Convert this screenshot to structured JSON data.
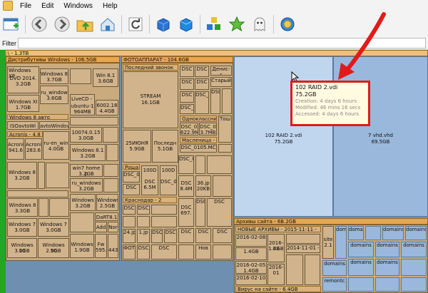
{
  "menu": [
    "File",
    "Edit",
    "Windows",
    "Help"
  ],
  "filter": {
    "label": "Filter",
    "value": ""
  },
  "treemap": {
    "root": "D:\\ - 1.3TB",
    "groups": {
      "distr": "Дистрибутивы Windows - 106.5GB",
      "photo": "ФОТОАППАРАТ - 104.6GB",
      "photo_last": "Последний звонок 62",
      "arch": "Архивы сайта - 6B.2GB",
      "new_arch": "НОВЫЕ АРХИВЫ - 2015-11-11 -",
      "virus": "Вирус на сайте - 6.4GB"
    },
    "items": {
      "raid": {
        "name": "102 RAID 2.vdi",
        "size": "75.2GB"
      },
      "vhd": {
        "name": "7 vhd.vhd",
        "size": "69.5GB"
      },
      "stream": {
        "name": "STREAM",
        "size": "16.1GB"
      },
      "jun": {
        "name": "25ИЮНЯ",
        "size": "5.9GB"
      },
      "last": {
        "name": "Последн",
        "size": "5.1GB"
      }
    },
    "labels": [
      "Windows XP",
      "DVD 2014.",
      "3.2GB",
      "Windows 8",
      "3.7GB",
      "Win 8.1",
      "3.6GB",
      "ru_window",
      "3.6GB",
      "Windows XI",
      "1.7GB",
      "LiveCD -",
      "ubuntu-1",
      "964MB",
      "6002.18",
      "4.4GB",
      "Windows 8 авто устано",
      "ISOavtoWi",
      "avtoWindov",
      "Acronis - 4.8",
      "Acroni",
      "941.6",
      "Acroni",
      "283.6",
      "ru-en_win",
      "4.0GB",
      "10074.0.15",
      "3.0GB",
      "Windows 8.1",
      "3.2GB",
      "Windows 8",
      "3.2GB",
      "win7 home p",
      "3.2GB",
      "ru_windows",
      "3.2GB",
      "Windows",
      "3.2GB",
      "Windows",
      "2.5GB",
      "Windows",
      "2.5GB",
      "Windows 8",
      "3.3GB",
      "Windows 7",
      "3.0GB",
      "Windows 7",
      "3.0GB",
      "DaRT8.1",
      "Add",
      "Nor",
      "Windows 10",
      "3.0GB",
      "Windows 10",
      "2.9GB",
      "Windows",
      "1.9GB",
      "Fw",
      "595.",
      "443"
    ],
    "dsc": [
      "DSC",
      "DSC",
      "DSC",
      "DSC",
      "DSC",
      "DSC_0",
      "DSC_0",
      "DSC",
      "Денис-с",
      "Старый",
      "Одноклассники",
      "Тош",
      "DSC_0",
      "DSC_0",
      "622.9M",
      "3.7MB",
      "Масленица - 9",
      "DSC_0105.MC",
      "Роша",
      "100D",
      "100D",
      "DSC_0",
      "DSC_0",
      "DSC",
      "DSC",
      "6.5M",
      "DSC_0",
      "Краснодар - 2",
      "DSC",
      "DSC",
      "8.4M",
      "36.jp",
      "20KB",
      "DSC",
      "DSC",
      "697.",
      "DSC",
      "DSC",
      "DSC",
      "ФОТ",
      "DSC",
      "DSC",
      "24.jp",
      "1.jp",
      "DSC",
      "DSC",
      "DSC",
      "DSC",
      "Нов"
    ],
    "arch_items": [
      "domains",
      "domai",
      "domains",
      "domains",
      "domains",
      "domains",
      "domains",
      "domains",
      "domains",
      "2016-03",
      "1.4GB",
      "2014-11-01 -",
      "site",
      "2.1",
      "2016-02-08",
      "1.4GB",
      "2016-02-05",
      "1.4GB",
      "2016-02-10",
      "2016-01",
      "domains",
      "remontc"
    ]
  },
  "tooltip": {
    "title": "102 RAID 2.vdi",
    "size": "75.2GB",
    "creation": "Creation: 4 days 6 hours",
    "modified": "Modified: 46 mins 16 secs",
    "accessed": "Accessed: 4 days 6 hours"
  },
  "colors": {
    "accent": "#e21a1a",
    "folder": "#d2b48c",
    "header": "#e8a64e",
    "selected": "#c0d6ef"
  }
}
